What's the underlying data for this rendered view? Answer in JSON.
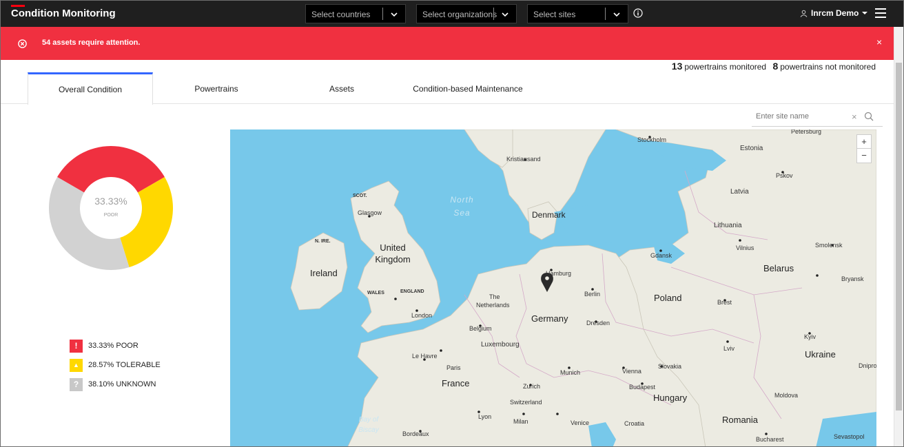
{
  "app": {
    "title": "Condition Monitoring"
  },
  "filters": {
    "countries_placeholder": "Select countries",
    "organizations_placeholder": "Select organizations",
    "sites_placeholder": "Select sites"
  },
  "user": {
    "name": "Inrcm Demo"
  },
  "alert": {
    "message": "54 assets require attention.",
    "close": "×"
  },
  "stats": {
    "monitored_count": "13",
    "monitored_label": "powertrains monitored",
    "not_monitored_count": "8",
    "not_monitored_label": "powertrains not monitored"
  },
  "tabs": [
    {
      "label": "Overall Condition",
      "active": true
    },
    {
      "label": "Powertrains",
      "active": false
    },
    {
      "label": "Assets",
      "active": false
    },
    {
      "label": "Condition-based Maintenance",
      "active": false
    }
  ],
  "site_search": {
    "placeholder": "Enter site name",
    "clear": "×"
  },
  "donut": {
    "center_value": "33.33%",
    "center_label": "POOR",
    "segments": [
      {
        "name": "POOR",
        "percent": 33.33,
        "color": "#f03040"
      },
      {
        "name": "TOLERABLE",
        "percent": 28.57,
        "color": "#ffd800"
      },
      {
        "name": "UNKNOWN",
        "percent": 38.1,
        "color": "#d2d2d2"
      }
    ]
  },
  "legend": [
    {
      "text": "33.33% POOR",
      "symbol": "!",
      "color": "#f03040"
    },
    {
      "text": "28.57% TOLERABLE",
      "symbol": "▲",
      "color": "#ffd800"
    },
    {
      "text": "38.10% UNKNOWN",
      "symbol": "?",
      "color": "#c8c8c8"
    }
  ],
  "map": {
    "zoom_in": "+",
    "zoom_out": "−",
    "labels": {
      "petersburg": "Petersburg",
      "stockholm": "Stockholm",
      "estonia": "Estonia",
      "kristiansand": "Kristiansand",
      "pskov": "Pskov",
      "north_sea": "North Sea",
      "scot": "SCOT.",
      "latvia": "Latvia",
      "glasgow": "Glasgow",
      "denmark": "Denmark",
      "nire": "N. IRE.",
      "lithuania": "Lithuania",
      "uk": "United Kingdom",
      "vilnius": "Vilnius",
      "smolensk": "Smolensk",
      "gdansk": "Gdansk",
      "ireland": "Ireland",
      "hamburg": "Hamburg",
      "belarus": "Belarus",
      "bryansk": "Bryansk",
      "wales": "WALES",
      "england": "ENGLAND",
      "the": "The",
      "netherlands": "Netherlands",
      "berlin": "Berlin",
      "poland": "Poland",
      "brest": "Brest",
      "london": "London",
      "germany": "Germany",
      "dresden": "Dresden",
      "belgium": "Belgium",
      "kyiv": "Kyiv",
      "luxembourg": "Luxembourg",
      "lviv": "Lviv",
      "le_havre": "Le Havre",
      "ukraine": "Ukraine",
      "paris": "Paris",
      "slovakia": "Slovakia",
      "dnipro": "Dnipro",
      "munich": "Munich",
      "vienna": "Vienna",
      "france": "France",
      "zurich": "Zurich",
      "budapest": "Budapest",
      "moldova": "Moldova",
      "hungary": "Hungary",
      "switzerland": "Switzerland",
      "bay_of_biscay": "Bay of Biscay",
      "lyon": "Lyon",
      "milan": "Milan",
      "venice": "Venice",
      "croatia": "Croatia",
      "romania": "Romania",
      "bordeaux": "Bordeaux",
      "bucharest": "Bucharest",
      "sevastopol": "Sevastopol"
    }
  }
}
